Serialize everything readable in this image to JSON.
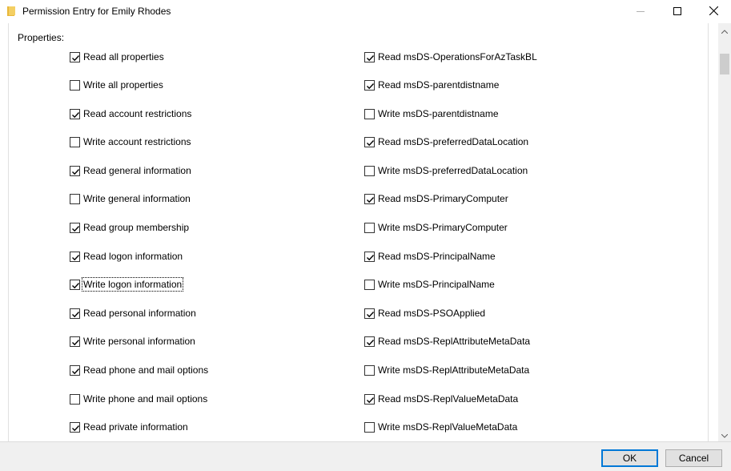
{
  "window": {
    "title": "Permission Entry for Emily Rhodes"
  },
  "properties_label": "Properties:",
  "left_items": [
    {
      "label": "Read all properties",
      "checked": true
    },
    {
      "label": "Write all properties",
      "checked": false
    },
    {
      "label": "Read account restrictions",
      "checked": true
    },
    {
      "label": "Write account restrictions",
      "checked": false
    },
    {
      "label": "Read general information",
      "checked": true
    },
    {
      "label": "Write general information",
      "checked": false
    },
    {
      "label": "Read group membership",
      "checked": true
    },
    {
      "label": "Read logon information",
      "checked": true
    },
    {
      "label": "Write logon information",
      "checked": true,
      "focused": true
    },
    {
      "label": "Read personal information",
      "checked": true
    },
    {
      "label": "Write personal information",
      "checked": true
    },
    {
      "label": "Read phone and mail options",
      "checked": true
    },
    {
      "label": "Write phone and mail options",
      "checked": false
    },
    {
      "label": "Read private information",
      "checked": true
    }
  ],
  "right_items": [
    {
      "label": "Read msDS-OperationsForAzTaskBL",
      "checked": true
    },
    {
      "label": "Read msDS-parentdistname",
      "checked": true
    },
    {
      "label": "Write msDS-parentdistname",
      "checked": false
    },
    {
      "label": "Read msDS-preferredDataLocation",
      "checked": true
    },
    {
      "label": "Write msDS-preferredDataLocation",
      "checked": false
    },
    {
      "label": "Read msDS-PrimaryComputer",
      "checked": true
    },
    {
      "label": "Write msDS-PrimaryComputer",
      "checked": false
    },
    {
      "label": "Read msDS-PrincipalName",
      "checked": true
    },
    {
      "label": "Write msDS-PrincipalName",
      "checked": false
    },
    {
      "label": "Read msDS-PSOApplied",
      "checked": true
    },
    {
      "label": "Read msDS-ReplAttributeMetaData",
      "checked": true
    },
    {
      "label": "Write msDS-ReplAttributeMetaData",
      "checked": false
    },
    {
      "label": "Read msDS-ReplValueMetaData",
      "checked": true
    },
    {
      "label": "Write msDS-ReplValueMetaData",
      "checked": false
    }
  ],
  "footer": {
    "ok_label": "OK",
    "cancel_label": "Cancel"
  }
}
